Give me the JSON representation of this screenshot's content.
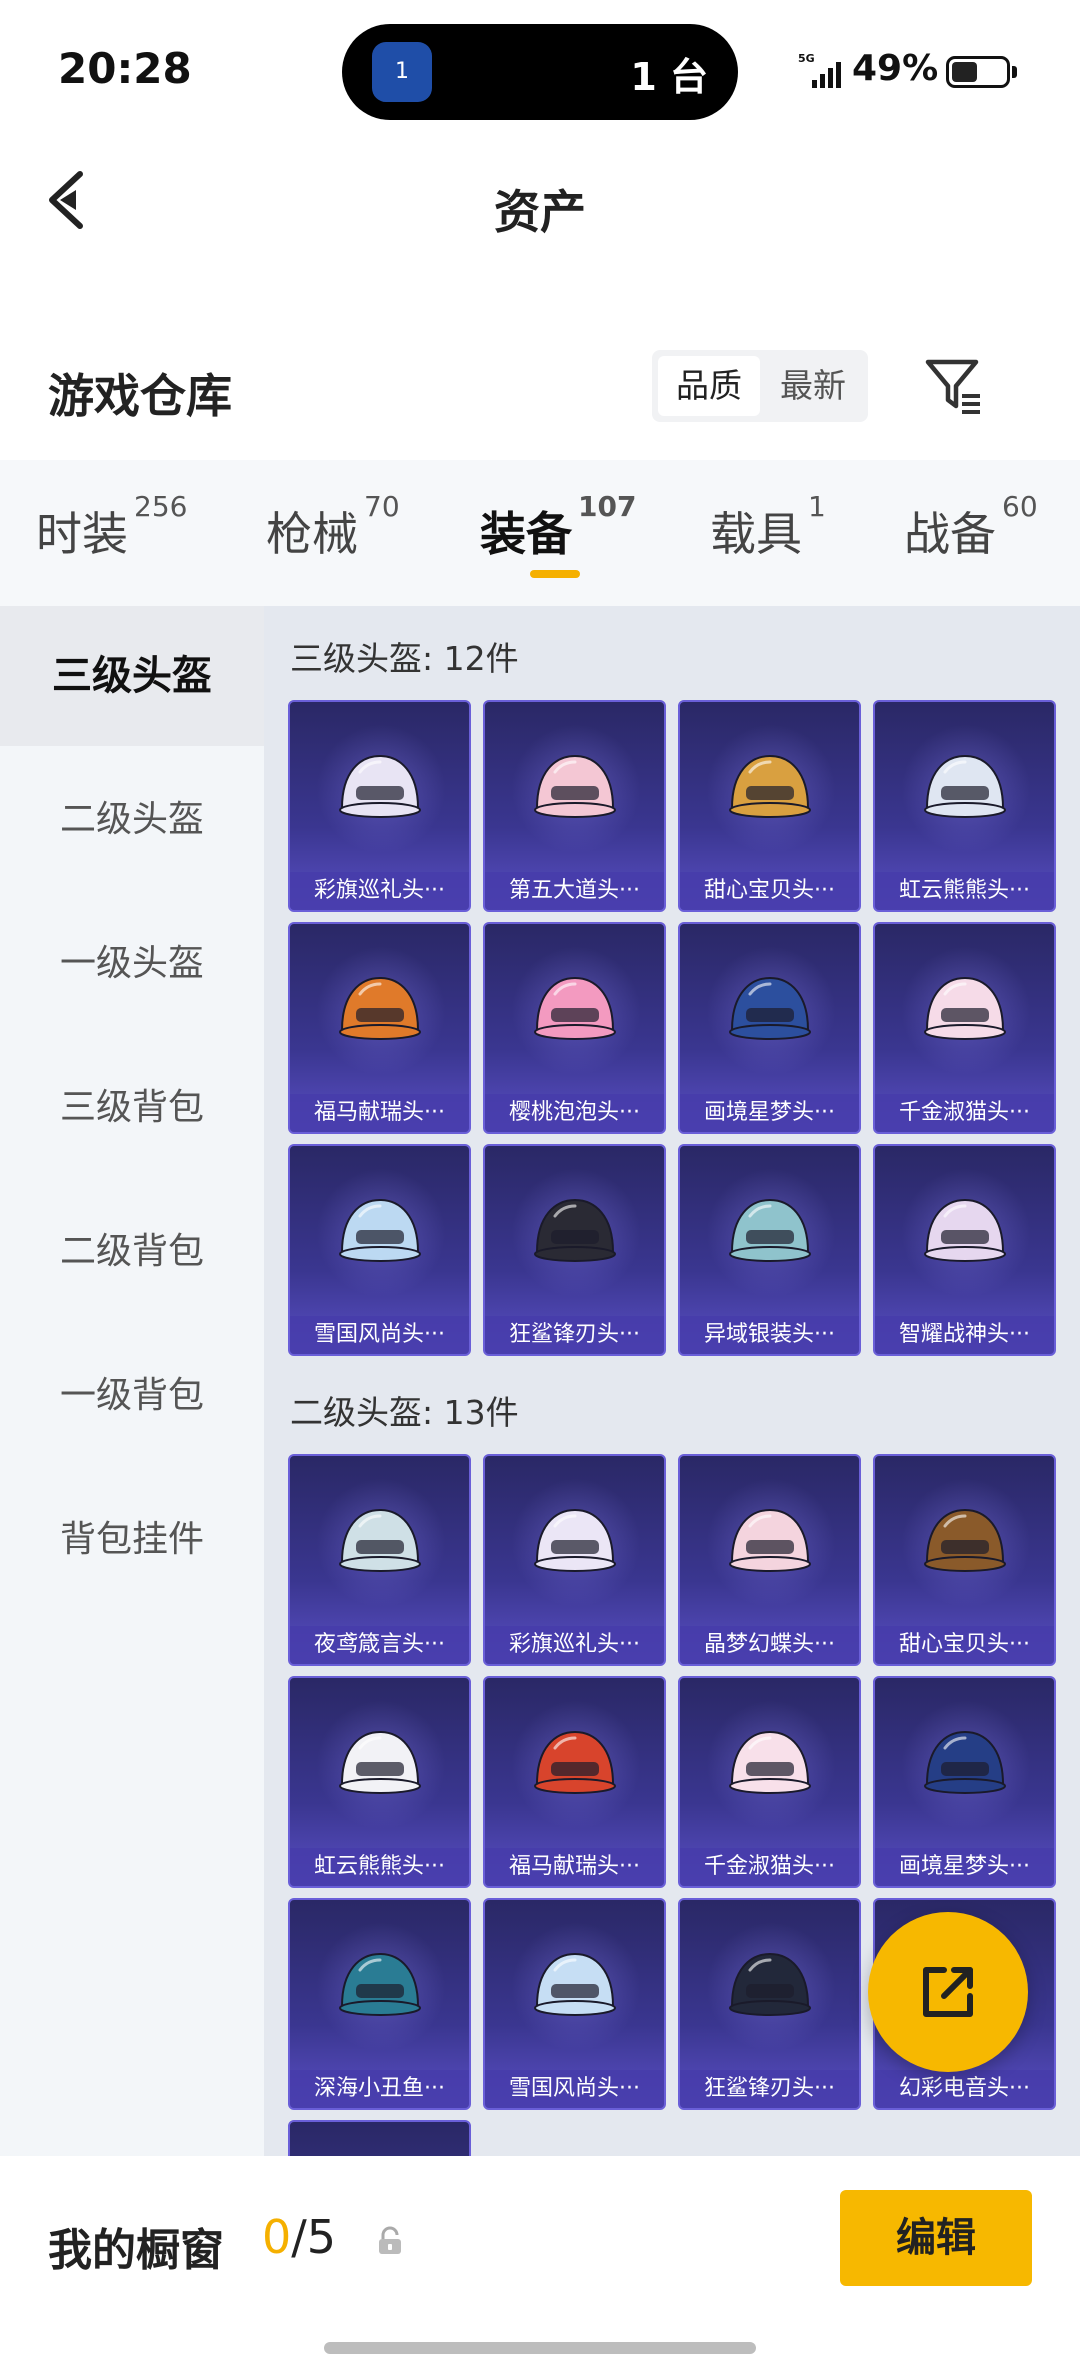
{
  "status_bar": {
    "time": "20:28",
    "island_app_badge": "1",
    "island_text": "1 台",
    "network": "5G",
    "battery_text": "49%",
    "battery_level": 0.49
  },
  "header": {
    "title": "资产"
  },
  "section": {
    "title": "游戏仓库",
    "sort_options": [
      "品质",
      "最新"
    ],
    "sort_selected": "品质"
  },
  "tabs": [
    {
      "label": "时装",
      "count": "256",
      "active": false
    },
    {
      "label": "枪械",
      "count": "70",
      "active": false
    },
    {
      "label": "装备",
      "count": "107",
      "active": true
    },
    {
      "label": "载具",
      "count": "1",
      "active": false
    },
    {
      "label": "战备",
      "count": "60",
      "active": false
    }
  ],
  "side_nav": [
    {
      "label": "三级头盔",
      "active": true
    },
    {
      "label": "二级头盔",
      "active": false
    },
    {
      "label": "一级头盔",
      "active": false
    },
    {
      "label": "三级背包",
      "active": false
    },
    {
      "label": "二级背包",
      "active": false
    },
    {
      "label": "一级背包",
      "active": false
    },
    {
      "label": "背包挂件",
      "active": false
    }
  ],
  "groups": [
    {
      "title": "三级头盔: 12件",
      "items": [
        {
          "name": "彩旗巡礼头···",
          "color": "#e8e4f4"
        },
        {
          "name": "第五大道头···",
          "color": "#f4c7d4"
        },
        {
          "name": "甜心宝贝头···",
          "color": "#d9a040"
        },
        {
          "name": "虹云熊熊头···",
          "color": "#dfe6f2"
        },
        {
          "name": "福马献瑞头···",
          "color": "#e07a2a"
        },
        {
          "name": "樱桃泡泡头···",
          "color": "#f39ac0"
        },
        {
          "name": "画境星梦头···",
          "color": "#2c4f9e"
        },
        {
          "name": "千金淑猫头···",
          "color": "#f6dbe8"
        },
        {
          "name": "雪国风尚头···",
          "color": "#bcd9f2"
        },
        {
          "name": "狂鲨锋刃头···",
          "color": "#2a2a34"
        },
        {
          "name": "异域银装头···",
          "color": "#8fc3cc"
        },
        {
          "name": "智耀战神头···",
          "color": "#e6d7ef"
        }
      ]
    },
    {
      "title": "二级头盔: 13件",
      "items": [
        {
          "name": "夜鸢箴言头···",
          "color": "#cfe0e6"
        },
        {
          "name": "彩旗巡礼头···",
          "color": "#ebe6f6"
        },
        {
          "name": "晶梦幻蝶头···",
          "color": "#f4d4de"
        },
        {
          "name": "甜心宝贝头···",
          "color": "#8a5a2a"
        },
        {
          "name": "虹云熊熊头···",
          "color": "#f2f2f6"
        },
        {
          "name": "福马献瑞头···",
          "color": "#d8442c"
        },
        {
          "name": "千金淑猫头···",
          "color": "#f8e0ea"
        },
        {
          "name": "画境星梦头···",
          "color": "#253e86"
        },
        {
          "name": "深海小丑鱼···",
          "color": "#2a7c94"
        },
        {
          "name": "雪国风尚头···",
          "color": "#c6def4"
        },
        {
          "name": "狂鲨锋刃头···",
          "color": "#22283a"
        },
        {
          "name": "幻彩电音头···",
          "color": "#6a5fd8"
        }
      ]
    }
  ],
  "showcase": {
    "label": "我的橱窗",
    "current": "0",
    "separator": "/",
    "max": "5",
    "edit_label": "编辑"
  },
  "colors": {
    "accent": "#f7b800",
    "card_bg": "#3a3690",
    "card_label_bg": "#463caa"
  }
}
